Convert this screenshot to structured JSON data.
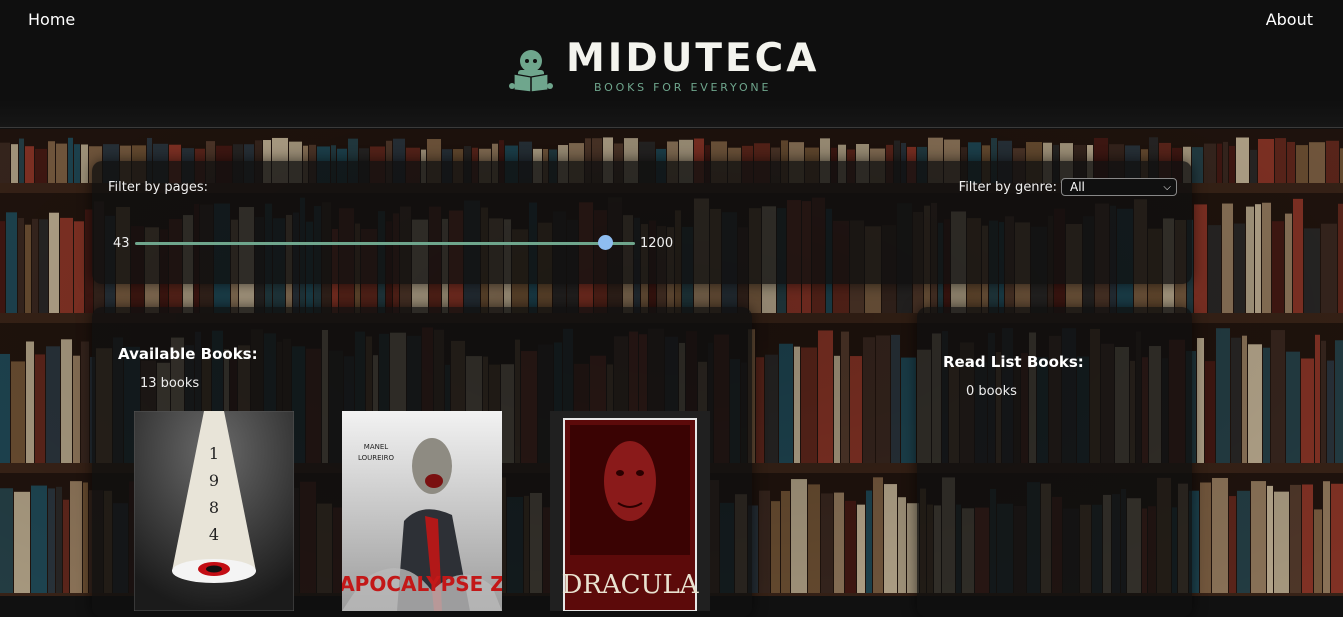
{
  "nav": {
    "home": "Home",
    "about": "About"
  },
  "brand": {
    "title": "MIDUTECA",
    "subtitle": "BOOKS FOR EVERYONE",
    "accent": "#6fa68d"
  },
  "filters": {
    "pages_label": "Filter by pages:",
    "pages_min": "43",
    "pages_max": "1200",
    "pages_value_fraction": 0.94,
    "genre_label": "Filter by genre:",
    "genre_selected": "All"
  },
  "available": {
    "title": "Available Books:",
    "count": "13 books",
    "books": [
      {
        "cover_text": "1984"
      },
      {
        "cover_author": "MANEL LOUREIRO",
        "cover_text": "APOCALYPSE Z"
      },
      {
        "cover_text": "DRACULA"
      }
    ]
  },
  "readlist": {
    "title": "Read List Books:",
    "count": "0 books"
  }
}
